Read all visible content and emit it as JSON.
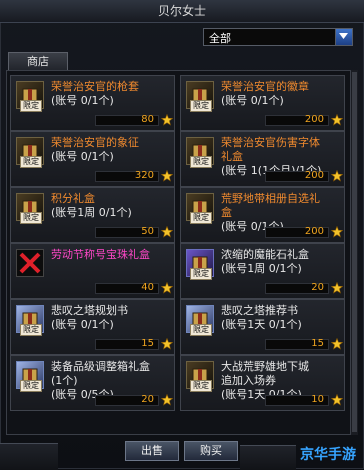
{
  "window": {
    "title": "贝尔女士"
  },
  "filter": {
    "selected": "全部"
  },
  "tabs": [
    {
      "label": "商店"
    }
  ],
  "items": [
    {
      "name_parts": [
        "荣誉治安官的枪套"
      ],
      "sub": "(账号 0/1个)",
      "price": "80",
      "name_color": "orange",
      "icon": "holster-icon",
      "limited": "限定"
    },
    {
      "name_parts": [
        "荣誉治安官的徽章"
      ],
      "sub": "(账号 0/1个)",
      "price": "200",
      "name_color": "orange",
      "icon": "sheriff-badge-icon",
      "limited": "限定"
    },
    {
      "name_parts": [
        "荣誉治安官的象征"
      ],
      "sub": "(账号 0/1个)",
      "price": "320",
      "name_color": "orange",
      "icon": "sheriff-emblem-icon",
      "limited": "限定"
    },
    {
      "name_parts": [
        "荣誉治安官伤害字体",
        "礼盒"
      ],
      "sub": "(账号 1(1个月)/1个)",
      "price": "200",
      "name_color": "orange",
      "icon": "font-giftbox-icon",
      "limited": "限定"
    },
    {
      "name_parts": [
        "积分礼盒"
      ],
      "sub": "(账号1周 0/1个)",
      "price": "50",
      "name_color": "orange",
      "icon": "points-giftbox-icon",
      "limited": "限定"
    },
    {
      "name_parts": [
        "荒野地带相册自选礼",
        "盒"
      ],
      "sub": "(账号 0/1个)",
      "price": "200",
      "name_color": "orange",
      "icon": "album-giftbox-icon",
      "limited": "限定"
    },
    {
      "name_parts": [
        "劳动节称号宝珠礼盒"
      ],
      "sub": "",
      "price": "40",
      "name_color": "magenta",
      "icon": "unavailable-x-icon",
      "limited": ""
    },
    {
      "name_parts": [
        "浓缩的魔能石礼盒"
      ],
      "sub": "(账号1周 0/1个)",
      "price": "20",
      "name_color": "white",
      "icon": "magic-stone-giftbox-icon",
      "limited": "限定"
    },
    {
      "name_parts": [
        "悲叹之塔规划书"
      ],
      "sub": "(账号 0/1个)",
      "price": "15",
      "name_color": "white",
      "icon": "tower-plan-book-icon",
      "limited": "限定"
    },
    {
      "name_parts": [
        "悲叹之塔推荐书"
      ],
      "sub": "(账号1天 0/1个)",
      "price": "15",
      "name_color": "white",
      "icon": "tower-recommend-book-icon",
      "limited": "限定"
    },
    {
      "name_parts": [
        "装备品级调整箱礼盒",
        "(1个)"
      ],
      "sub": "(账号 0/5个)",
      "price": "20",
      "name_color": "white",
      "icon": "grade-adjust-box-icon",
      "limited": "限定"
    },
    {
      "name_parts": [
        "大战荒野雄地下城",
        "追加入场券"
      ],
      "sub": "(账号1天 0/1个)",
      "price": "10",
      "name_color": "white",
      "icon": "dungeon-ticket-icon",
      "limited": "限定"
    }
  ],
  "buttons": {
    "sell": "出售",
    "buy": "购买"
  },
  "watermark": "京华手游",
  "colors": {
    "orange": "#f08a2e",
    "magenta": "#ff47c8",
    "price": "#f0a51f",
    "accent": "#2f6ad0"
  }
}
